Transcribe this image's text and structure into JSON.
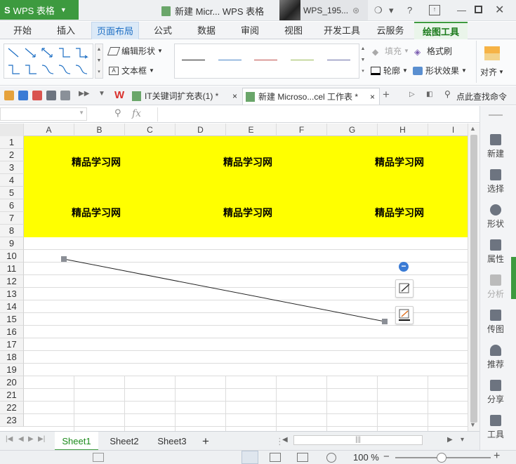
{
  "titlebar": {
    "app_button": "WPS 表格",
    "doc_title": "新建 Micr... WPS 表格",
    "username": "WPS_195..."
  },
  "ribbon_tabs": [
    "开始",
    "插入",
    "页面布局",
    "公式",
    "数据",
    "审阅",
    "视图",
    "开发工具",
    "云服务",
    "绘图工具"
  ],
  "active_ribbon_tab": "页面布局",
  "context_tab": "绘图工具",
  "ribbon": {
    "edit_shape": "编辑形状",
    "textbox": "文本框",
    "fill": "填充",
    "format_painter": "格式刷",
    "outline": "轮廓",
    "shape_effect": "形状效果",
    "align": "对齐",
    "line_style_colors": [
      "#222222",
      "#4a86c8",
      "#c0504d",
      "#9bbb59",
      "#6b6fa8"
    ]
  },
  "doc_tabs": [
    {
      "label": "IT关键词扩充表(1) *",
      "close": "×"
    },
    {
      "label": "新建 Microso...cel 工作表 *",
      "close": "×"
    }
  ],
  "quick_find": "点此查找命令",
  "formula_bar": {
    "fx": "fx",
    "name_box": ""
  },
  "columns": [
    "A",
    "B",
    "C",
    "D",
    "E",
    "F",
    "G",
    "H",
    "I"
  ],
  "rows": [
    "1",
    "2",
    "3",
    "4",
    "5",
    "6",
    "7",
    "8",
    "9",
    "10",
    "11",
    "12",
    "13",
    "14",
    "15",
    "16",
    "17",
    "18",
    "19",
    "20",
    "21",
    "22",
    "23"
  ],
  "cell_texts": [
    "精品学习网",
    "精品学习网",
    "精品学习网",
    "精品学习网",
    "精品学习网",
    "精品学习网"
  ],
  "highlight_color": "#ffff00",
  "side_panel": [
    "新建",
    "选择",
    "形状",
    "属性",
    "分析",
    "传图",
    "推荐",
    "分享",
    "工具"
  ],
  "sheets": [
    "Sheet1",
    "Sheet2",
    "Sheet3"
  ],
  "active_sheet": "Sheet1",
  "add_sheet": "+",
  "zoom": "100 %"
}
